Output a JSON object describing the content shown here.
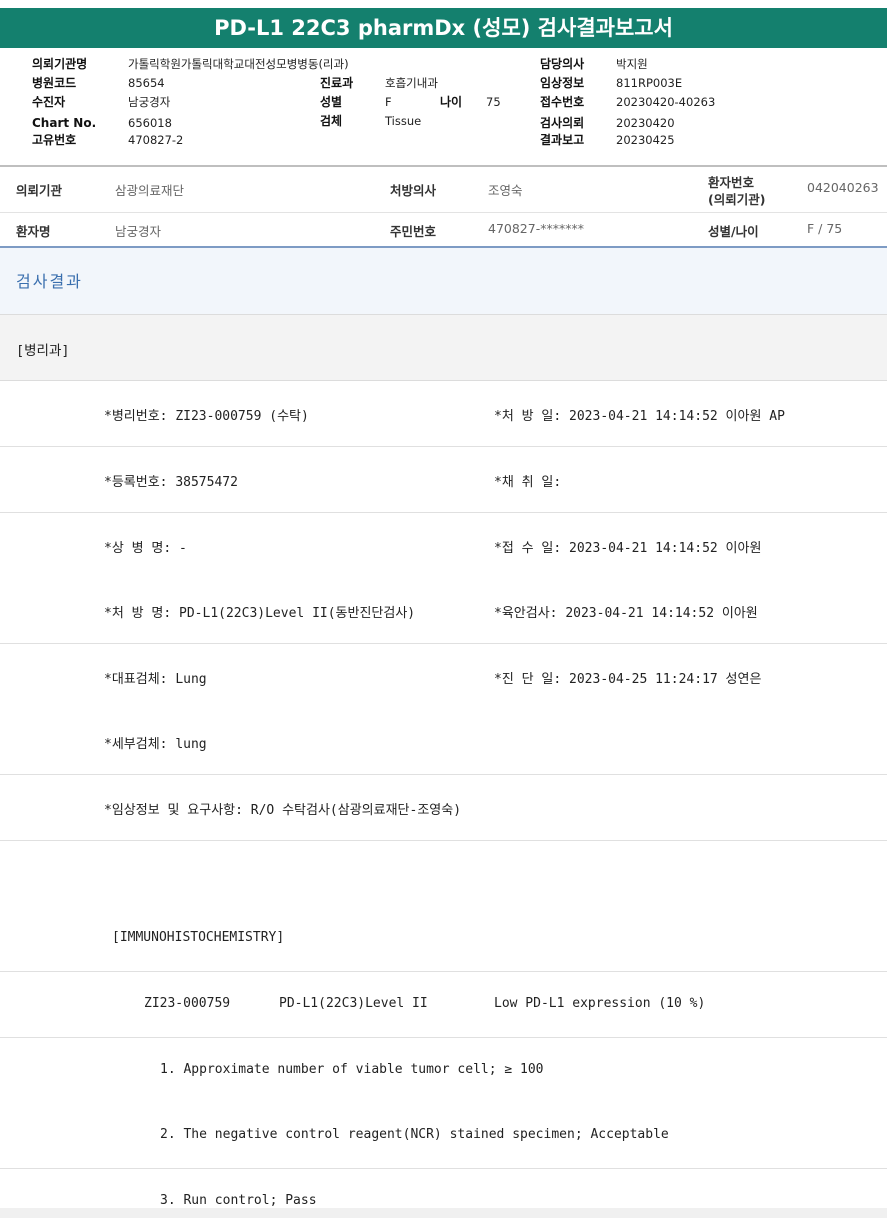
{
  "title": "PD-L1 22C3 pharmDx (성모) 검사결과보고서",
  "top_info": {
    "requesting_institution_label": "의뢰기관명",
    "requesting_institution": "가톨릭학원가톨릭대학교대전성모병병동(리과)",
    "doctor_label": "담당의사",
    "doctor": "박지원",
    "hospital_code_label": "병원코드",
    "hospital_code": "85654",
    "department_label": "진료과",
    "department": "호흡기내과",
    "clinical_info_label": "임상정보",
    "clinical_info": "811RP003E",
    "examinee_label": "수진자",
    "examinee": "남궁경자",
    "sex_label": "성별",
    "sex": "F",
    "age_label": "나이",
    "age": "75",
    "receipt_no_label": "접수번호",
    "receipt_no": "20230420-40263",
    "chart_no_label": "Chart No.",
    "chart_no": "656018",
    "specimen_label": "검체",
    "specimen": "Tissue",
    "test_request_label": "검사의뢰",
    "test_request": "20230420",
    "unique_no_label": "고유번호",
    "unique_no": "470827-2",
    "result_report_label": "결과보고",
    "result_report": "20230425"
  },
  "patient_table": {
    "institution_label": "의뢰기관",
    "institution": "삼광의료재단",
    "prescriber_label": "처방의사",
    "prescriber": "조영숙",
    "patient_no_label_1": "환자번호",
    "patient_no_label_2": "(의뢰기관)",
    "patient_no": "042040263",
    "patient_name_label": "환자명",
    "patient_name": "남궁경자",
    "resident_no_label": "주민번호",
    "resident_no": "470827-*******",
    "sex_age_label": "성별/나이",
    "sex_age": "F / 75"
  },
  "result_section": {
    "heading": "검사결과",
    "department": "[병리과]",
    "rows": [
      {
        "left": "*병리번호: ZI23-000759 (수탁)",
        "right": "*처 방 일: 2023-04-21 14:14:52  이아원 AP"
      },
      {
        "left": "*등록번호: 38575472",
        "right": "*채 취 일:"
      },
      {
        "left": "*상 병 명: -",
        "right": "*접 수 일: 2023-04-21 14:14:52  이아원"
      },
      {
        "left": "*처 방 명: PD-L1(22C3)Level II(동반진단검사)",
        "right": "*육안검사: 2023-04-21 14:14:52  이아원"
      },
      {
        "left": "*대표검체: Lung",
        "right": "*진 단 일: 2023-04-25 11:24:17  성연은"
      },
      {
        "left": "*세부검체: lung",
        "right": ""
      },
      {
        "left": "*임상정보 및 요구사항: R/O 수탁검사(삼광의료재단-조영숙)",
        "right": ""
      }
    ],
    "ihc_heading": "[IMMUNOHISTOCHEMISTRY]",
    "ihc_case": "ZI23-000759",
    "ihc_test": "PD-L1(22C3)Level II",
    "ihc_result": "Low PD-L1 expression (10 %)",
    "item1": "1. Approximate number of viable tumor cell; ≥ 100",
    "item2": "2. The negative control reagent(NCR) stained specimen; Acceptable",
    "item3": "3. Run control; Pass"
  }
}
